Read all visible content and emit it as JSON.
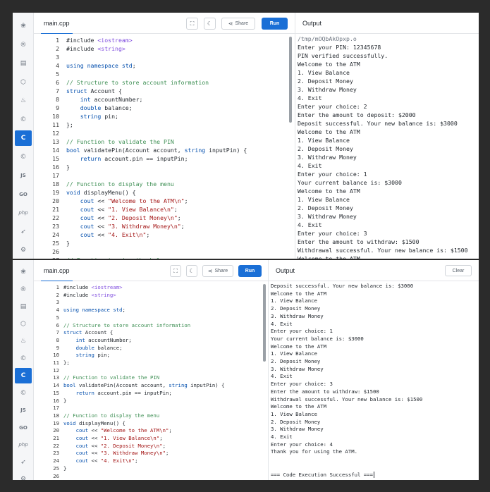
{
  "top": {
    "file_tab": "main.cpp",
    "share_label": "Share",
    "run_label": "Run",
    "output_title": "Output",
    "code_lines": [
      {
        "n": "1",
        "t": "#include <iostream>"
      },
      {
        "n": "2",
        "t": "#include <string>"
      },
      {
        "n": "3",
        "t": ""
      },
      {
        "n": "4",
        "t": "using namespace std;"
      },
      {
        "n": "5",
        "t": ""
      },
      {
        "n": "6",
        "t": "// Structure to store account information"
      },
      {
        "n": "7",
        "t": "struct Account {"
      },
      {
        "n": "8",
        "t": "    int accountNumber;"
      },
      {
        "n": "9",
        "t": "    double balance;"
      },
      {
        "n": "10",
        "t": "    string pin;"
      },
      {
        "n": "11",
        "t": "};"
      },
      {
        "n": "12",
        "t": ""
      },
      {
        "n": "13",
        "t": "// Function to validate the PIN"
      },
      {
        "n": "14",
        "t": "bool validatePin(Account account, string inputPin) {"
      },
      {
        "n": "15",
        "t": "    return account.pin == inputPin;"
      },
      {
        "n": "16",
        "t": "}"
      },
      {
        "n": "17",
        "t": ""
      },
      {
        "n": "18",
        "t": "// Function to display the menu"
      },
      {
        "n": "19",
        "t": "void displayMenu() {"
      },
      {
        "n": "20",
        "t": "    cout << \"Welcome to the ATM\\n\";"
      },
      {
        "n": "21",
        "t": "    cout << \"1. View Balance\\n\";"
      },
      {
        "n": "22",
        "t": "    cout << \"2. Deposit Money\\n\";"
      },
      {
        "n": "23",
        "t": "    cout << \"3. Withdraw Money\\n\";"
      },
      {
        "n": "24",
        "t": "    cout << \"4. Exit\\n\";"
      },
      {
        "n": "25",
        "t": "}"
      },
      {
        "n": "26",
        "t": ""
      },
      {
        "n": "27",
        "t": "// Function to view the balance"
      }
    ],
    "output_lines": [
      "/tmp/mOQbAkOpxp.o",
      "Enter your PIN: 12345678",
      "PIN verified successfully.",
      "Welcome to the ATM",
      "1. View Balance",
      "2. Deposit Money",
      "3. Withdraw Money",
      "4. Exit",
      "Enter your choice: 2",
      "Enter the amount to deposit: $2000",
      "Deposit successful. Your new balance is: $3000",
      "Welcome to the ATM",
      "1. View Balance",
      "2. Deposit Money",
      "3. Withdraw Money",
      "4. Exit",
      "Enter your choice: 1",
      "Your current balance is: $3000",
      "Welcome to the ATM",
      "1. View Balance",
      "2. Deposit Money",
      "3. Withdraw Money",
      "4. Exit",
      "Enter your choice: 3",
      "Enter the amount to withdraw: $1500",
      "Withdrawal successful. Your new balance is: $1500",
      "Welcome to the ATM"
    ]
  },
  "bottom": {
    "file_tab": "main.cpp",
    "share_label": "Share",
    "run_label": "Run",
    "output_title": "Output",
    "clear_label": "Clear",
    "code_lines": [
      {
        "n": "1",
        "t": "#include <iostream>"
      },
      {
        "n": "2",
        "t": "#include <string>"
      },
      {
        "n": "3",
        "t": ""
      },
      {
        "n": "4",
        "t": "using namespace std;"
      },
      {
        "n": "5",
        "t": ""
      },
      {
        "n": "6",
        "t": "// Structure to store account information"
      },
      {
        "n": "7",
        "t": "struct Account {"
      },
      {
        "n": "8",
        "t": "    int accountNumber;"
      },
      {
        "n": "9",
        "t": "    double balance;"
      },
      {
        "n": "10",
        "t": "    string pin;"
      },
      {
        "n": "11",
        "t": "};"
      },
      {
        "n": "12",
        "t": ""
      },
      {
        "n": "13",
        "t": "// Function to validate the PIN"
      },
      {
        "n": "14",
        "t": "bool validatePin(Account account, string inputPin) {"
      },
      {
        "n": "15",
        "t": "    return account.pin == inputPin;"
      },
      {
        "n": "16",
        "t": "}"
      },
      {
        "n": "17",
        "t": ""
      },
      {
        "n": "18",
        "t": "// Function to display the menu"
      },
      {
        "n": "19",
        "t": "void displayMenu() {"
      },
      {
        "n": "20",
        "t": "    cout << \"Welcome to the ATM\\n\";"
      },
      {
        "n": "21",
        "t": "    cout << \"1. View Balance\\n\";"
      },
      {
        "n": "22",
        "t": "    cout << \"2. Deposit Money\\n\";"
      },
      {
        "n": "23",
        "t": "    cout << \"3. Withdraw Money\\n\";"
      },
      {
        "n": "24",
        "t": "    cout << \"4. Exit\\n\";"
      },
      {
        "n": "25",
        "t": "}"
      },
      {
        "n": "26",
        "t": ""
      }
    ],
    "output_lines": [
      "Deposit successful. Your new balance is: $3000",
      "Welcome to the ATM",
      "1. View Balance",
      "2. Deposit Money",
      "3. Withdraw Money",
      "4. Exit",
      "Enter your choice: 1",
      "Your current balance is: $3000",
      "Welcome to the ATM",
      "1. View Balance",
      "2. Deposit Money",
      "3. Withdraw Money",
      "4. Exit",
      "Enter your choice: 3",
      "Enter the amount to withdraw: $1500",
      "Withdrawal successful. Your new balance is: $1500",
      "Welcome to the ATM",
      "1. View Balance",
      "2. Deposit Money",
      "3. Withdraw Money",
      "4. Exit",
      "Enter your choice: 4",
      "Thank you for using the ATM.",
      "",
      "",
      "=== Code Execution Successful ==="
    ]
  },
  "sidebar_icons": [
    "python-icon",
    "r-icon",
    "sql-icon",
    "html-icon",
    "java-icon",
    "c-icon",
    "cpp-icon",
    "csharp-icon",
    "js-icon",
    "go-icon",
    "php-icon",
    "swift-icon",
    "rust-icon"
  ],
  "sidebar_labels": {
    "js": "JS",
    "go": "GO",
    "php": "php"
  },
  "colors": {
    "accent": "#1a6fd6",
    "comment": "#3e8f54",
    "keyword": "#0550ae",
    "string": "#a31515"
  }
}
